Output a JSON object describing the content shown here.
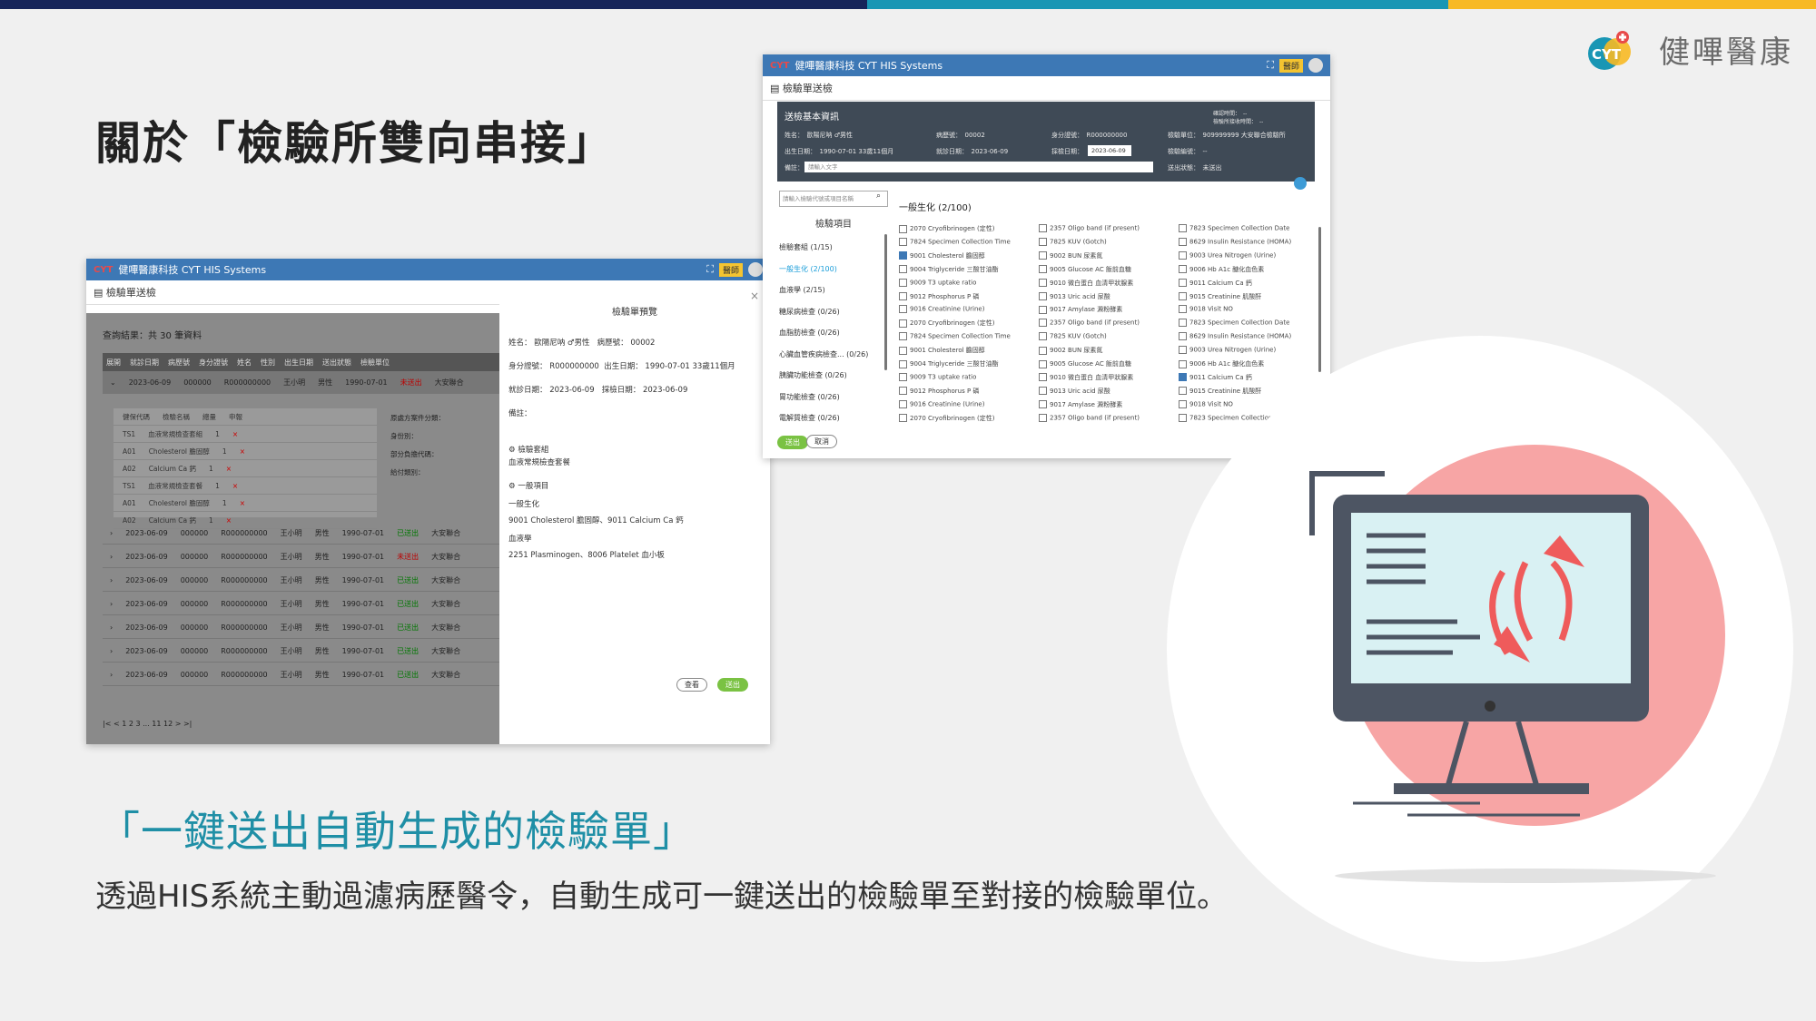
{
  "colors": {
    "bar_navy": "#16245a",
    "bar_teal": "#1996b4",
    "bar_yellow": "#f7b924",
    "subtitle": "#1f8fa6",
    "window_bar": "#3d78b5",
    "pink": "#f7a5a5",
    "monitor": "#4d5563",
    "screen": "#d9f1f3",
    "arrow": "#ef5b5b"
  },
  "brand": {
    "name": "健嗶醫康"
  },
  "page_title": "關於「檢驗所雙向串接」",
  "subtitle": "「一鍵送出自動生成的檢驗單」",
  "description": "透過HIS系統主動過濾病歷醫令，自動生成可一鍵送出的檢驗單至對接的檢驗單位。",
  "back_window": {
    "title": "健嗶醫康科技 CYT HIS Systems",
    "doctor_btn": "醫師",
    "section": "檢驗單送檢",
    "result": "查詢結果：共 30 筆資料",
    "headers": [
      "展開",
      "就診日期",
      "病歷號",
      "身分證號",
      "姓名",
      "性別",
      "出生日期",
      "送出狀態",
      "檢驗單位"
    ],
    "first_row": [
      "2023-06-09",
      "000000",
      "R000000000",
      "王小明",
      "男性",
      "1990-07-01",
      "未送出",
      "大安聯合"
    ],
    "sub_headers": [
      "健保代碼",
      "檢驗名稱",
      "總量",
      "申報"
    ],
    "sub_rows": [
      [
        "TS1",
        "血液常規檢查套組",
        "1",
        "×"
      ],
      [
        "A01",
        "Cholesterol 膽固醇",
        "1",
        "×"
      ],
      [
        "A02",
        "Calcium Ca 鈣",
        "1",
        "×"
      ],
      [
        "TS1",
        "血液常規檢查套餐",
        "1",
        "×"
      ],
      [
        "A01",
        "Cholesterol 膽固醇",
        "1",
        "×"
      ],
      [
        "A02",
        "Calcium Ca 鈣",
        "1",
        "×"
      ]
    ],
    "side_labels": [
      "原處方案件分類：",
      "身份別：",
      "部分負擔代碼：",
      "給付類別："
    ],
    "rows": [
      [
        "2023-06-09",
        "000000",
        "R000000000",
        "王小明",
        "男性",
        "1990-07-01",
        "已送出",
        "大安聯合"
      ],
      [
        "2023-06-09",
        "000000",
        "R000000000",
        "王小明",
        "男性",
        "1990-07-01",
        "未送出",
        "大安聯合"
      ],
      [
        "2023-06-09",
        "000000",
        "R000000000",
        "王小明",
        "男性",
        "1990-07-01",
        "已送出",
        "大安聯合"
      ],
      [
        "2023-06-09",
        "000000",
        "R000000000",
        "王小明",
        "男性",
        "1990-07-01",
        "已送出",
        "大安聯合"
      ],
      [
        "2023-06-09",
        "000000",
        "R000000000",
        "王小明",
        "男性",
        "1990-07-01",
        "已送出",
        "大安聯合"
      ],
      [
        "2023-06-09",
        "000000",
        "R000000000",
        "王小明",
        "男性",
        "1990-07-01",
        "已送出",
        "大安聯合"
      ],
      [
        "2023-06-09",
        "000000",
        "R000000000",
        "王小明",
        "男性",
        "1990-07-01",
        "已送出",
        "大安聯合"
      ]
    ],
    "pager": "1 2 3 ... 11 12",
    "preview": {
      "title": "檢驗單預覽",
      "close": "×",
      "name_label": "姓名：",
      "name": "歐陽尼呐 ♂男性",
      "chart_label": "病歷號：",
      "chart_no": "00002",
      "id_label": "身分證號：",
      "id_no": "R000000000",
      "dob_label": "出生日期：",
      "dob": "1990-07-01 33歲11個月",
      "visit_label": "就診日期：",
      "visit": "2023-06-09",
      "sample_label": "採檢日期：",
      "sample": "2023-06-09",
      "note_label": "備註：",
      "set_title": "檢驗套組",
      "set_item": "血液常規檢查套餐",
      "general_title": "一般項目",
      "gen_chem": "一般生化",
      "gen_chem_items": "9001 Cholesterol 膽固醇、9011 Calcium Ca 鈣",
      "blood": "血液學",
      "blood_items": "2251 Plasminogen、8006 Platelet 血小板",
      "view_btn": "查看",
      "send_btn": "送出"
    }
  },
  "front_window": {
    "title": "健嗶醫康科技 CYT HIS Systems",
    "doctor_btn": "醫師",
    "section": "檢驗單送檢",
    "info_title": "送檢基本資訊",
    "info": {
      "name": "姓名：　歐陽尼呐 ♂男性",
      "chart": "病歷號：　00002",
      "id": "身分證號：　R000000000",
      "unit": "檢驗單位：　909999999 大安聯合檢驗所",
      "dob": "出生日期：　1990-07-01 33歲11個月",
      "visit": "就診日期：　2023-06-09",
      "sample_label": "採檢日期：",
      "sample": "2023-06-09",
      "lab_no": "檢驗編號：　--",
      "note_label": "備註：",
      "note_placeholder": "請輸入文字",
      "send_status": "送出狀態：　未送出",
      "top_right1": "確認時間：　--",
      "top_right2": "檢驗所接收時間：　--"
    },
    "search_placeholder": "請輸入檢驗代號或項目名稱",
    "side_head": "檢驗項目",
    "side_items": [
      "檢驗套組 (1/15)",
      "一般生化 (2/100)",
      "血液學 (2/15)",
      "糖尿病檢查 (0/26)",
      "血脂肪檢查 (0/26)",
      "心臟血管疾病檢查... (0/26)",
      "胰臟功能檢查 (0/26)",
      "胃功能檢查 (0/26)",
      "電解質檢查 (0/26)"
    ],
    "group_title": "一般生化 (2/100)",
    "col1": [
      "2070 Cryofibrinogen (定性)",
      "7824 Specimen Collection Time",
      "9001 Cholesterol 膽固醇",
      "9004 Triglyceride 三酸甘油酯",
      "9009 T3 uptake ratio",
      "9012 Phosphorus P 磷",
      "9016 Creatinine (Urine)",
      "2070 Cryofibrinogen (定性)",
      "7824 Specimen Collection Time",
      "9001 Cholesterol 膽固醇",
      "9004 Triglyceride 三酸甘油酯",
      "9009 T3 uptake ratio",
      "9012 Phosphorus P 磷",
      "9016 Creatinine (Urine)",
      "2070 Cryofibrinogen (定性)"
    ],
    "col2": [
      "2357 Oligo band (if present)",
      "7825 KUV (Gotch)",
      "9002 BUN 尿素氮",
      "9005 Glucose AC 飯前血糖",
      "9010 微白蛋白 血清甲狀腺素",
      "9013 Uric acid 尿酸",
      "9017 Amylase 澱粉酵素",
      "2357 Oligo band (if present)",
      "7825 KUV (Gotch)",
      "9002 BUN 尿素氮",
      "9005 Glucose AC 飯前血糖",
      "9010 微白蛋白 血清甲狀腺素",
      "9013 Uric acid 尿酸",
      "9017 Amylase 澱粉酵素",
      "2357 Oligo band (if present)"
    ],
    "col3": [
      "7823 Specimen Collection Date",
      "8629 Insulin Resistance (HOMA)",
      "9003 Urea Nitrogen (Urine)",
      "9006 Hb A1c 醣化血色素",
      "9011 Calcium Ca 鈣",
      "9015 Creatinine 肌酸酐",
      "9018 Visit NO",
      "7823 Specimen Collection Date",
      "8629 Insulin Resistance (HOMA)",
      "9003 Urea Nitrogen (Urine)",
      "9006 Hb A1c 醣化血色素",
      "9011 Calcium Ca 鈣",
      "9015 Creatinine 肌酸酐",
      "9018 Visit NO",
      "7823 Specimen Collection Date"
    ],
    "send_btn": "送出",
    "cancel_btn": "取消"
  }
}
